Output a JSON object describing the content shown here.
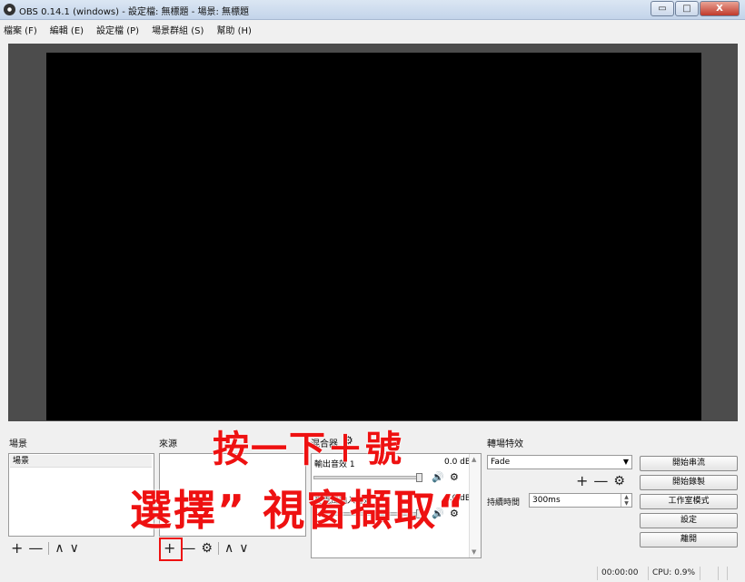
{
  "window": {
    "title": "OBS 0.14.1 (windows) - 設定檔: 無標題 - 場景: 無標題",
    "minimize_glyph": "▭",
    "maximize_glyph": "□",
    "close_glyph": "X"
  },
  "menu": {
    "items": [
      {
        "label": "檔案 (F)"
      },
      {
        "label": "編輯 (E)"
      },
      {
        "label": "設定檔 (P)"
      },
      {
        "label": "場景群組 (S)"
      },
      {
        "label": "幫助 (H)"
      }
    ]
  },
  "docks": {
    "scenes_title": "場景",
    "sources_title": "來源",
    "mixer_title": "混合器",
    "transitions_title": "轉場特效"
  },
  "scenes": {
    "items": [
      {
        "label": "場景"
      }
    ]
  },
  "toolbar_glyphs": {
    "add": "+",
    "remove": "—",
    "gear": "⚙",
    "up": "∧",
    "down": "∨"
  },
  "mixer": {
    "channels": [
      {
        "name": "輸出音效 1",
        "db": "0.0 dB",
        "volume": 1.0
      },
      {
        "name": "麥克風輸入音效 1",
        "db": "0.0 dB",
        "volume": 1.0
      }
    ],
    "speaker_glyph": "🔊"
  },
  "transitions": {
    "selected": "Fade",
    "duration_label": "持續時間",
    "duration_value": "300ms"
  },
  "controls": {
    "start_streaming": "開始串流",
    "start_recording": "開始錄製",
    "studio_mode": "工作室模式",
    "settings": "設定",
    "exit": "離開"
  },
  "status": {
    "time": "00:00:00",
    "cpu": "CPU: 0.9%"
  },
  "annotations": {
    "line1": "按一下＋號",
    "line2": "選擇” 視窗擷取“",
    "color": "#ee1111"
  }
}
